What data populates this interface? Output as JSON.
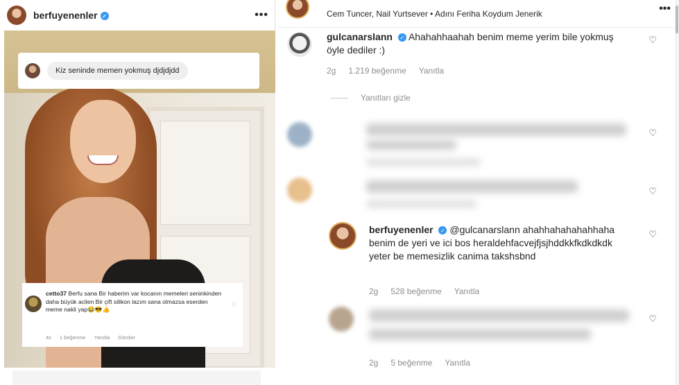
{
  "left_post": {
    "username": "berfuyenenler",
    "more_label": "•••",
    "dm_message": "Kiz seninde memen yokmuş djdjdjdd",
    "inner_comment": {
      "username": "cetto37",
      "text": "Berfu sana Bir haberim var kocanın memeleri seninkinden daha büyük acilen Bir çift silikon lazım sana olmazsa eserden meme nakli yap😂😎👍",
      "time": "4s",
      "likes": "1 beğenme",
      "reply_label": "Yanıtla",
      "send_label": "Gönder"
    }
  },
  "right_panel": {
    "top_caption": "Cem Tuncer, Nail Yurtsever • Adını Feriha Koydum Jenerik",
    "more_label": "•••",
    "comments": [
      {
        "username": "gulcanarslann",
        "text": "Ahahahhaahah benim meme yerim bile yokmuş öyle dediler :)",
        "time": "2g",
        "likes": "1.219 beğenme",
        "reply_label": "Yanıtla"
      },
      {
        "username": "berfuyenenler",
        "mention": "@gulcanarslann",
        "text": "ahahhahahahahhaha benim de yeri ve ici bos heraldehfacvejfjsjhddkkfkdkdkdk yeter be memesizlik canima takshsbnd",
        "time": "2g",
        "likes": "528 beğenme",
        "reply_label": "Yanıtla"
      },
      {
        "time": "2g",
        "likes": "5 beğenme",
        "reply_label": "Yanıtla"
      }
    ],
    "hide_replies_label": "Yanıtları gizle"
  },
  "colors": {
    "verified_blue": "#3897f0",
    "meta_gray": "#8e8e8e",
    "text": "#262626"
  },
  "icons": {
    "verified": "verified-badge-icon",
    "heart": "heart-outline-icon",
    "more": "more-dots-icon"
  }
}
